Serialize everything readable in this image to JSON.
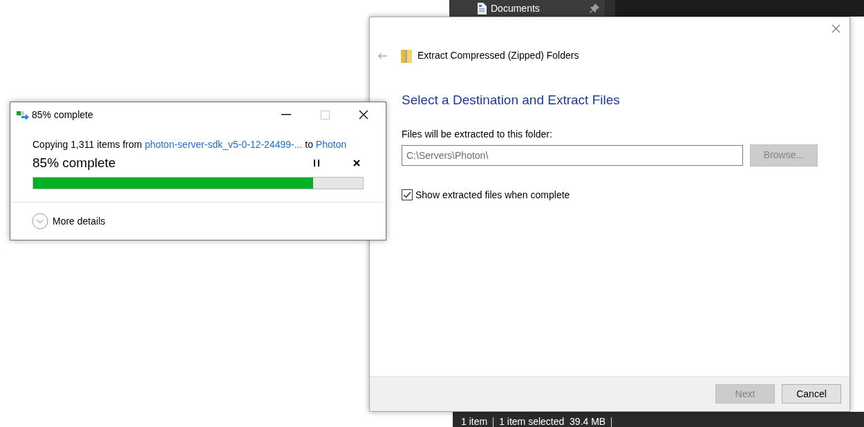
{
  "explorer": {
    "quick_access_item": {
      "label": "Documents"
    },
    "status_bar": [
      "1 item",
      "1 item selected  39.4 MB"
    ]
  },
  "copy_dialog": {
    "title": "85% complete",
    "message": [
      {
        "kind": "text",
        "text": "Copying 1,311 items from "
      },
      {
        "kind": "link",
        "text": "photon-server-sdk_v5-0-12-24499-..."
      },
      {
        "kind": "text",
        "text": " to "
      },
      {
        "kind": "link",
        "text": "Photon"
      }
    ],
    "heading": "85% complete",
    "progress": {
      "level": 0.85
    },
    "more_details": "More details"
  },
  "extract_wizard": {
    "title": "Extract Compressed (Zipped) Folders",
    "heading": "Select a Destination and Extract Files",
    "folder_label": "Files will be extracted to this folder:",
    "folder_field": {
      "value": "C:\\Servers\\Photon\\"
    },
    "browse_button": {
      "label": "Browse...",
      "disabled": true
    },
    "show_files": {
      "label": "Show extracted files when complete",
      "checked": true
    },
    "buttons": [
      {
        "label": "Next",
        "disabled": true
      },
      {
        "label": "Cancel",
        "disabled": false
      }
    ]
  }
}
